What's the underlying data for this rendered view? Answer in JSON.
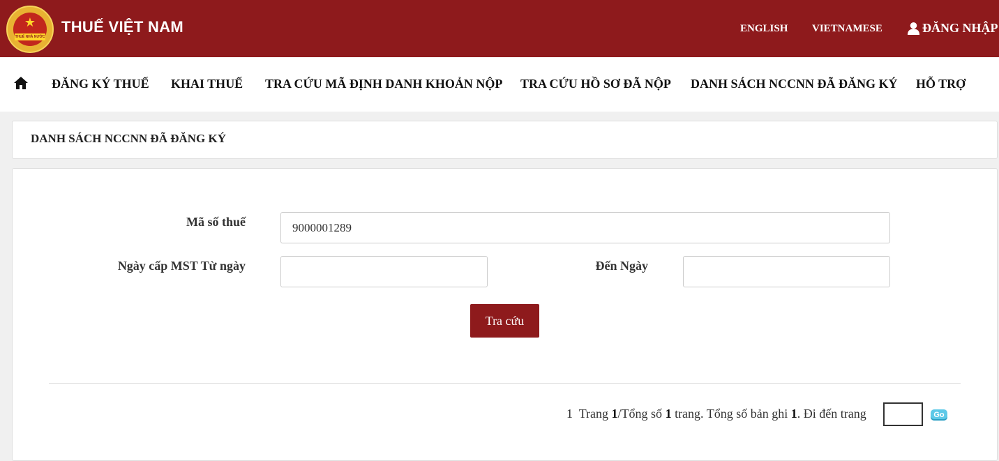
{
  "colors": {
    "brand": "#8e1a1c",
    "go_button": "#5ec9e8",
    "logo_gold": "#e8b232"
  },
  "header": {
    "logo_icon": "national-emblem",
    "logo_text": "THUẾ NHÀ NƯỚC",
    "brand": "THUẾ VIỆT NAM",
    "languages": [
      "ENGLISH",
      "VIETNAMESE"
    ],
    "login_icon": "user-icon",
    "login": "ĐĂNG NHẬP"
  },
  "nav": {
    "home_icon": "home-icon",
    "items": [
      "ĐĂNG KÝ THUẾ",
      "KHAI THUẾ",
      "TRA CỨU MÃ ĐỊNH DANH KHOẢN NỘP",
      "TRA CỨU HỒ SƠ ĐÃ NỘP",
      "DANH SÁCH NCCNN ĐÃ ĐĂNG KÝ",
      "HỖ TRỢ"
    ]
  },
  "page": {
    "title": "DANH SÁCH NCCNN ĐÃ ĐĂNG KÝ"
  },
  "form": {
    "tax_code_label": "Mã số thuế",
    "tax_code_value": "9000001289",
    "from_date_label": "Ngày cấp MST Từ ngày",
    "from_date_value": "",
    "to_date_label": "Đến Ngày",
    "to_date_value": "",
    "search_button": "Tra cứu"
  },
  "pagination": {
    "page_link": "1",
    "text_trang": "Trang",
    "current_page": "1",
    "text_total_pages_prefix": "/Tổng số",
    "total_pages": "1",
    "text_total_records_prefix": "trang. Tổng số bản ghi",
    "total_records": "1",
    "text_goto": ". Đi đến trang",
    "goto_value": "",
    "go_button": "Go"
  }
}
